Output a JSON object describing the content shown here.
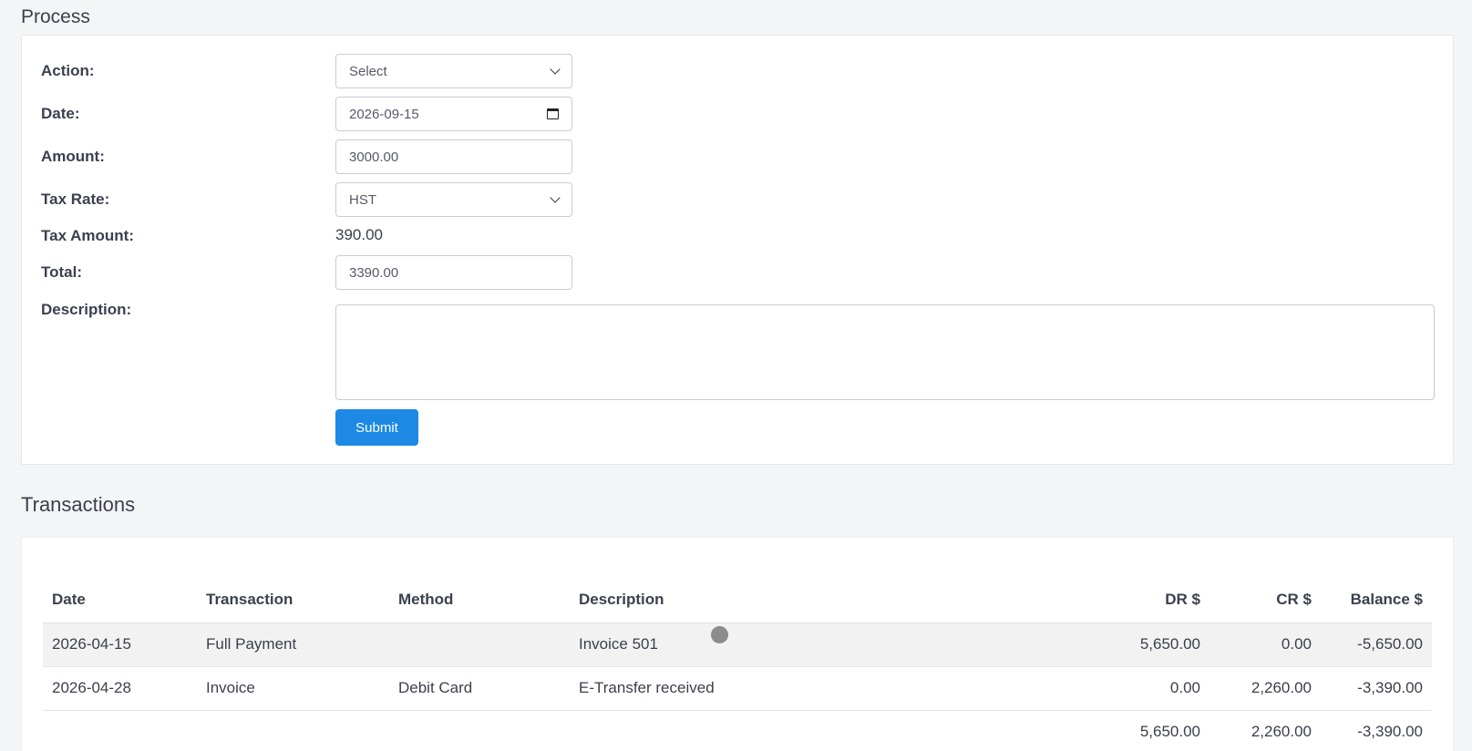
{
  "process": {
    "title": "Process",
    "fields": {
      "action": {
        "label": "Action:",
        "value": "Select"
      },
      "date": {
        "label": "Date:",
        "value": "2026-09-15"
      },
      "amount": {
        "label": "Amount:",
        "value": "3000.00"
      },
      "tax_rate": {
        "label": "Tax Rate:",
        "value": "HST"
      },
      "tax_amount": {
        "label": "Tax Amount:",
        "value": "390.00"
      },
      "total": {
        "label": "Total:",
        "value": "3390.00"
      },
      "description": {
        "label": "Description:",
        "value": ""
      }
    },
    "submit_label": "Submit"
  },
  "transactions": {
    "title": "Transactions",
    "columns": {
      "date": "Date",
      "transaction": "Transaction",
      "method": "Method",
      "description": "Description",
      "dr": "DR $",
      "cr": "CR $",
      "balance": "Balance $"
    },
    "rows": [
      {
        "date": "2026-04-15",
        "transaction": "Full Payment",
        "method": "",
        "description": "Invoice 501",
        "dr": "5,650.00",
        "cr": "0.00",
        "balance": "-5,650.00"
      },
      {
        "date": "2026-04-28",
        "transaction": "Invoice",
        "method": "Debit Card",
        "description": "E-Transfer received",
        "dr": "0.00",
        "cr": "2,260.00",
        "balance": "-3,390.00"
      }
    ],
    "totals": {
      "dr": "5,650.00",
      "cr": "2,260.00",
      "balance": "-3,390.00"
    }
  },
  "colors": {
    "accent": "#1e88e5",
    "background": "#f4f5f7"
  }
}
